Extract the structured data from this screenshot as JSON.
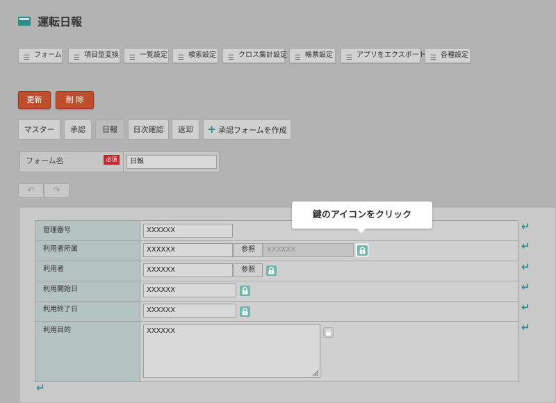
{
  "header": {
    "title": "運転日報",
    "icon": "window-icon"
  },
  "top_tabs": [
    {
      "label": "フォーム"
    },
    {
      "label": "項目型変換"
    },
    {
      "label": "一覧設定"
    },
    {
      "label": "検索設定"
    },
    {
      "label": "クロス集計設定"
    },
    {
      "label": "帳票設定"
    },
    {
      "label": "アプリをエクスポート"
    },
    {
      "label": "各種設定"
    }
  ],
  "actions": {
    "update": "更新",
    "delete": "削 除"
  },
  "form_tabs": [
    {
      "label": "マスター"
    },
    {
      "label": "承認"
    },
    {
      "label": "日報"
    },
    {
      "label": "日次確認"
    },
    {
      "label": "返却"
    },
    {
      "label": "承認フォームを作成",
      "icon": "plus-icon"
    }
  ],
  "form_name": {
    "label": "フォーム名",
    "required": "必須",
    "value": "日報"
  },
  "undo_redo": {
    "undo_icon": "undo-icon",
    "redo_icon": "redo-icon"
  },
  "fields": [
    {
      "label": "管理番号",
      "value": "XXXXXX"
    },
    {
      "label": "利用者所属",
      "value": "XXXXXX",
      "ref_label": "参照",
      "ref_value": "XXXXXX"
    },
    {
      "label": "利用者",
      "value": "XXXXXX",
      "ref_label": "参照"
    },
    {
      "label": "利用開始日",
      "value": "XXXXXX"
    },
    {
      "label": "利用終了日",
      "value": "XXXXXX"
    },
    {
      "label": "利用目的",
      "value": "XXXXXX"
    }
  ],
  "tooltip": {
    "text": "鍵のアイコンをクリック"
  },
  "colors": {
    "accent": "#2a8e8a",
    "danger": "#bf4f2c",
    "required": "#c0282b",
    "label_bg": "#b5c2c2"
  }
}
